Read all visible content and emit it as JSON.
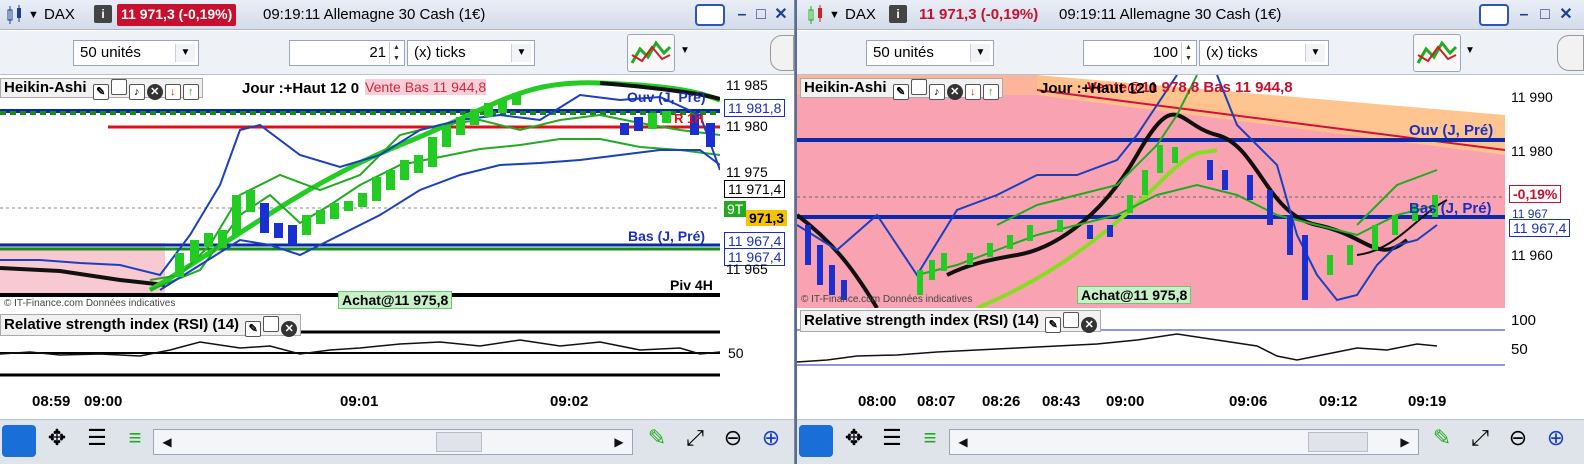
{
  "left": {
    "title": {
      "instrument": "DAX",
      "price_change": "11 971,3 (-0,19%)",
      "time_name": "09:19:11 Allemagne 30 Cash (1€)"
    },
    "toolbar": {
      "units": "50 unités",
      "tick_count": "21",
      "tick_unit": "(x) ticks"
    },
    "indicator": {
      "name": "Heikin-Ashi",
      "info": "Jour :+Haut 12 0",
      "info_overlap": "Vente Bas 11 944,8"
    },
    "axis": {
      "labels": [
        "11 985",
        "11 980",
        "11 975",
        "11 965"
      ],
      "badge_current": "11 971,4",
      "badge_981": "11 981,8",
      "badge_9t": "9T",
      "badge_3": "971,3",
      "badge_967a": "11 967,4",
      "badge_967b": "11 967,4"
    },
    "annotations": {
      "ouv": "Ouv (J, Pré)",
      "bas": "Bas (J, Pré)",
      "piv": "Piv 4H",
      "achat": "Achat@11 975,8",
      "copyright": "© IT-Finance.com  Données indicatives",
      "r1h": "R 1H"
    },
    "rsi": {
      "title": "Relative strength index (RSI) (14)",
      "level_50": "50"
    },
    "xaxis": [
      "08:59",
      "09:00",
      "09:01",
      "09:02"
    ]
  },
  "right": {
    "title": {
      "instrument": "DAX",
      "price_change": "11 971,3 (-0,19%)",
      "time_name": "09:19:11 Allemagne 30 Cash (1€)"
    },
    "toolbar": {
      "units": "50 unités",
      "tick_count": "100",
      "tick_unit": "(x) ticks"
    },
    "indicator": {
      "name": "Heikin-Ashi",
      "info": "Jour :+Haut 12 0",
      "info_overlap": "Vente@11 978,8 Bas 11 944,8"
    },
    "axis": {
      "labels": [
        "11 990",
        "11 980",
        "11 960"
      ],
      "badge_pct": "-0,19%",
      "badge_967": "11 967,4",
      "badge_967_hidden": "11 967"
    },
    "annotations": {
      "ouv": "Ouv (J, Pré)",
      "bas": "Bas (J, Pré)",
      "achat": "Achat@11 975,8",
      "copyright": "© IT-Finance.com  Données indicatives"
    },
    "rsi": {
      "title": "Relative strength index (RSI) (14)",
      "level_100": "100",
      "level_50": "50"
    },
    "xaxis": [
      "08:00",
      "08:07",
      "08:26",
      "08:43",
      "09:00",
      "09:06",
      "09:12",
      "09:19"
    ]
  },
  "colors": {
    "title_bg": "#dce3ef",
    "badge_red": "#c8102e",
    "accent_blue": "#1a3f8f",
    "green": "#22aa22",
    "pink": "#f7a5b0"
  }
}
